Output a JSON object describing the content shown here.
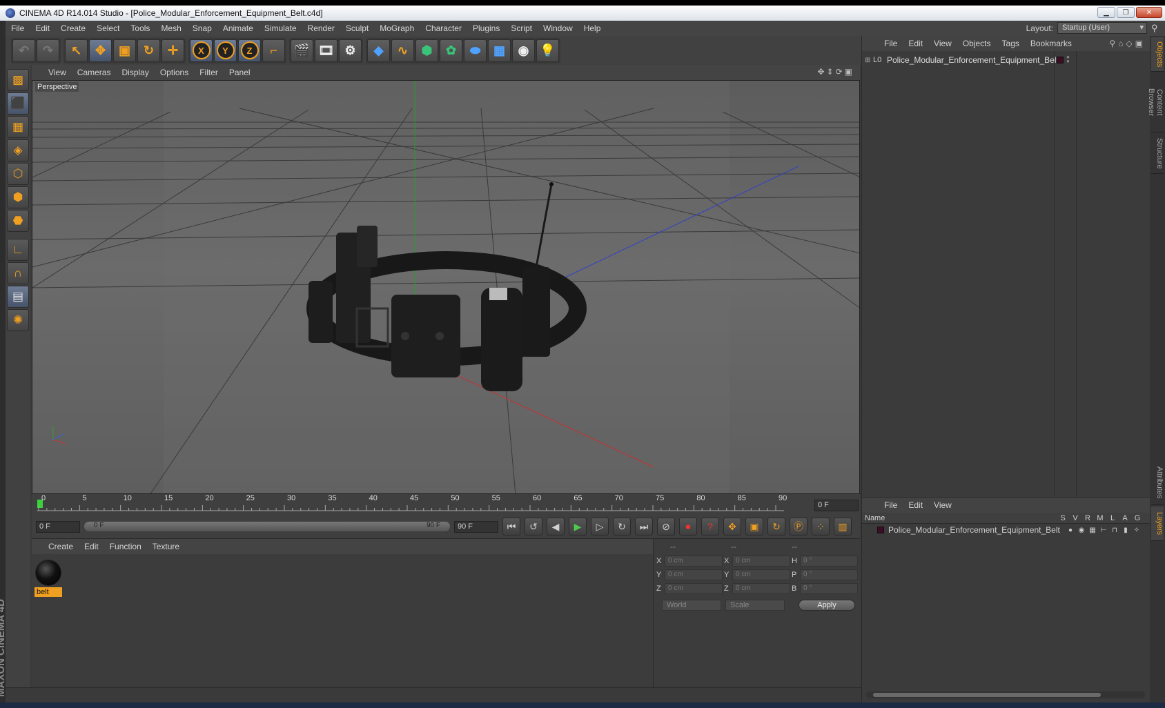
{
  "window": {
    "title": "CINEMA 4D R14.014 Studio - [Police_Modular_Enforcement_Equipment_Belt.c4d]"
  },
  "menu": [
    "File",
    "Edit",
    "Create",
    "Select",
    "Tools",
    "Mesh",
    "Snap",
    "Animate",
    "Simulate",
    "Render",
    "Sculpt",
    "MoGraph",
    "Character",
    "Plugins",
    "Script",
    "Window",
    "Help"
  ],
  "layout": {
    "label": "Layout:",
    "value": "Startup (User)"
  },
  "viewport": {
    "menu": [
      "View",
      "Cameras",
      "Display",
      "Options",
      "Filter",
      "Panel"
    ],
    "label": "Perspective"
  },
  "timeline": {
    "ticks": [
      "0",
      "5",
      "10",
      "15",
      "20",
      "25",
      "30",
      "35",
      "40",
      "45",
      "50",
      "55",
      "60",
      "65",
      "70",
      "75",
      "80",
      "85",
      "90"
    ],
    "current": "0 F"
  },
  "transport": {
    "start": "0 F",
    "slider_left": "0 F",
    "slider_right": "90 F",
    "end": "90 F"
  },
  "materials": {
    "menu": [
      "Create",
      "Edit",
      "Function",
      "Texture"
    ],
    "items": [
      {
        "name": "belt"
      }
    ]
  },
  "coords": {
    "headers": [
      "--",
      "--",
      "--"
    ],
    "rows": [
      {
        "a1": "X",
        "v1": "0 cm",
        "a2": "X",
        "v2": "0 cm",
        "a3": "H",
        "v3": "0 °"
      },
      {
        "a1": "Y",
        "v1": "0 cm",
        "a2": "Y",
        "v2": "0 cm",
        "a3": "P",
        "v3": "0 °"
      },
      {
        "a1": "Z",
        "v1": "0 cm",
        "a2": "Z",
        "v2": "0 cm",
        "a3": "B",
        "v3": "0 °"
      }
    ],
    "space": "World",
    "mode": "Scale",
    "apply": "Apply"
  },
  "objects": {
    "menu": [
      "File",
      "Edit",
      "View",
      "Objects",
      "Tags",
      "Bookmarks"
    ],
    "items": [
      {
        "name": "Police_Modular_Enforcement_Equipment_Belt"
      }
    ]
  },
  "layers": {
    "menu": [
      "File",
      "Edit",
      "View"
    ],
    "columns": [
      "Name",
      "S",
      "V",
      "R",
      "M",
      "L",
      "A",
      "G"
    ],
    "items": [
      {
        "name": "Police_Modular_Enforcement_Equipment_Belt"
      }
    ]
  },
  "side_tabs": {
    "top": [
      "Objects",
      "Content Browser",
      "Structure"
    ],
    "bottom": [
      "Attributes",
      "Layers"
    ]
  },
  "brand": "MAXON CINEMA 4D"
}
